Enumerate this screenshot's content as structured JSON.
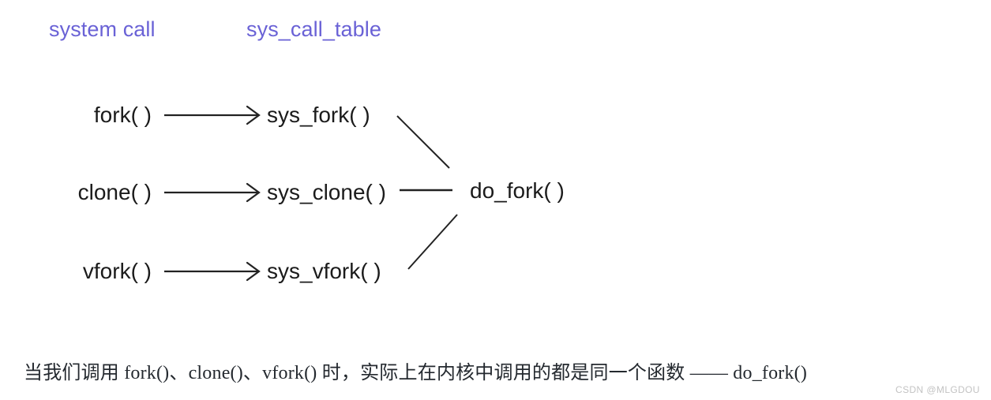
{
  "headers": {
    "left": "system call",
    "right": "sys_call_table"
  },
  "colors": {
    "header_text": "#6a62d6",
    "body_text": "#1b1b1b",
    "caption_text": "#24292f",
    "line": "#222222",
    "watermark": "#c3c3c3",
    "background": "#ffffff"
  },
  "rows": [
    {
      "user_call": "fork( )",
      "sys_call": "sys_fork( )"
    },
    {
      "user_call": "clone( )",
      "sys_call": "sys_clone( )"
    },
    {
      "user_call": "vfork( )",
      "sys_call": "sys_vfork( )"
    }
  ],
  "target": {
    "label": "do_fork( )"
  },
  "caption": {
    "text": "当我们调用 fork()、clone()、vfork() 时，实际上在内核中调用的都是同一个函数 —— do_fork()"
  },
  "watermark": {
    "text": "CSDN @MLGDOU"
  }
}
